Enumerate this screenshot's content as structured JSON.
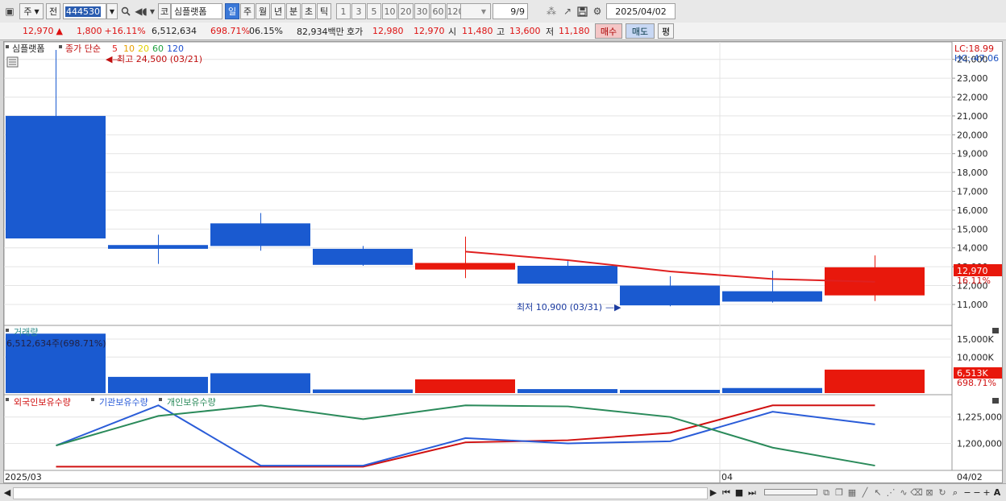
{
  "toolbar": {
    "market_label": "주",
    "prev_label": "전",
    "code": "444530",
    "code_type": "코",
    "stock_name": "심플랫폼",
    "periods": [
      "일",
      "주",
      "월",
      "년",
      "분",
      "초",
      "틱"
    ],
    "active_period": "일",
    "intervals": [
      "1",
      "3",
      "5",
      "10",
      "20",
      "30",
      "60",
      "120"
    ],
    "count": "9/9",
    "date": "2025/04/02"
  },
  "quote": {
    "price": "12,970",
    "arrow": "▲",
    "change": "1,800",
    "change_pct": "+16.11%",
    "volume": "6,512,634",
    "volume_pct": "698.71%",
    "turnover": "06.15%",
    "amount": "82,934백만",
    "bid_label": "호가",
    "bid1": "12,980",
    "bid2": "12,970",
    "open_label": "시",
    "open": "11,480",
    "high_label": "고",
    "high": "13,600",
    "low_label": "저",
    "low": "11,180",
    "buy_label": "매수",
    "sell_label": "매도",
    "avg_label": "평"
  },
  "legend": {
    "name": "심플랫폼",
    "ma_title": "종가 단순",
    "ma_periods": [
      "5",
      "10",
      "20",
      "60",
      "120"
    ],
    "ma_colors": [
      "#e02020",
      "#e8a000",
      "#e0d000",
      "#20a040",
      "#2050d0"
    ],
    "lc": "LC:18.99",
    "hc": "HC:-47.06"
  },
  "annotations": {
    "high_note": "최고 24,500 (03/21)",
    "low_note": "최저 10,900 (03/31)"
  },
  "price_axis": {
    "ticks": [
      "24,000",
      "23,000",
      "22,000",
      "21,000",
      "20,000",
      "19,000",
      "18,000",
      "17,000",
      "16,000",
      "15,000",
      "14,000",
      "13,000",
      "12,000",
      "11,000"
    ],
    "current_price": "12,970",
    "current_pct": "16.11%"
  },
  "volume_panel": {
    "title": "거래량",
    "value_label": "6,512,634주(698.71%)",
    "ticks": [
      "15,000K",
      "10,000K"
    ],
    "current": "6,513K",
    "current_pct": "698.71%"
  },
  "holdings_panel": {
    "series_labels": [
      "외국인보유수량",
      "기관보유수량",
      "개인보유수량"
    ],
    "series_colors": [
      "#d01010",
      "#2a5cd8",
      "#2a8a5a"
    ],
    "ticks": [
      "1,225,000",
      "1,200,000"
    ]
  },
  "x_axis": {
    "left_label": "2025/03",
    "mid_label": "04",
    "right_label": "04/02"
  },
  "chart_data": {
    "type": "candlestick",
    "colors": {
      "up": "#e8180c",
      "down": "#1a5ad0",
      "ma5": "#e02020"
    },
    "price_ylim": [
      10400,
      24500
    ],
    "candles": [
      {
        "o": 21000,
        "h": 24500,
        "l": 14500,
        "c": 14500,
        "dir": "down"
      },
      {
        "o": 14150,
        "h": 14700,
        "l": 13150,
        "c": 13950,
        "dir": "down"
      },
      {
        "o": 15300,
        "h": 15850,
        "l": 13850,
        "c": 14100,
        "dir": "down"
      },
      {
        "o": 13950,
        "h": 14100,
        "l": 13050,
        "c": 13100,
        "dir": "down"
      },
      {
        "o": 12850,
        "h": 14600,
        "l": 12400,
        "c": 13200,
        "dir": "up"
      },
      {
        "o": 13050,
        "h": 13300,
        "l": 12150,
        "c": 12100,
        "dir": "down"
      },
      {
        "o": 12000,
        "h": 12500,
        "l": 10900,
        "c": 10950,
        "dir": "down"
      },
      {
        "o": 11700,
        "h": 12800,
        "l": 11100,
        "c": 11150,
        "dir": "down"
      },
      {
        "o": 11480,
        "h": 13600,
        "l": 11180,
        "c": 12970,
        "dir": "up"
      }
    ],
    "ma5": [
      null,
      null,
      null,
      null,
      13800,
      13350,
      12750,
      12350,
      12200
    ],
    "volume_ylim": [
      0,
      17000
    ],
    "volumes": [
      {
        "v": 16500,
        "dir": "down"
      },
      {
        "v": 4500,
        "dir": "down"
      },
      {
        "v": 5500,
        "dir": "down"
      },
      {
        "v": 1000,
        "dir": "down"
      },
      {
        "v": 3800,
        "dir": "up"
      },
      {
        "v": 1100,
        "dir": "down"
      },
      {
        "v": 900,
        "dir": "down"
      },
      {
        "v": 1400,
        "dir": "down"
      },
      {
        "v": 6513,
        "dir": "up"
      }
    ],
    "holdings_ylim": [
      1176000,
      1240000
    ],
    "holdings": [
      {
        "name": "외국인보유수량",
        "values": [
          1178000,
          1178000,
          1178000,
          1178000,
          1201000,
          1203000,
          1210000,
          1236000,
          1236000
        ]
      },
      {
        "name": "기관보유수량",
        "values": [
          1198000,
          1236000,
          1179000,
          1179000,
          1205000,
          1200000,
          1202000,
          1230000,
          1218000
        ]
      },
      {
        "name": "개인보유수량",
        "values": [
          1198000,
          1226000,
          1236000,
          1223000,
          1236000,
          1235000,
          1225000,
          1196000,
          1179000
        ]
      }
    ]
  }
}
